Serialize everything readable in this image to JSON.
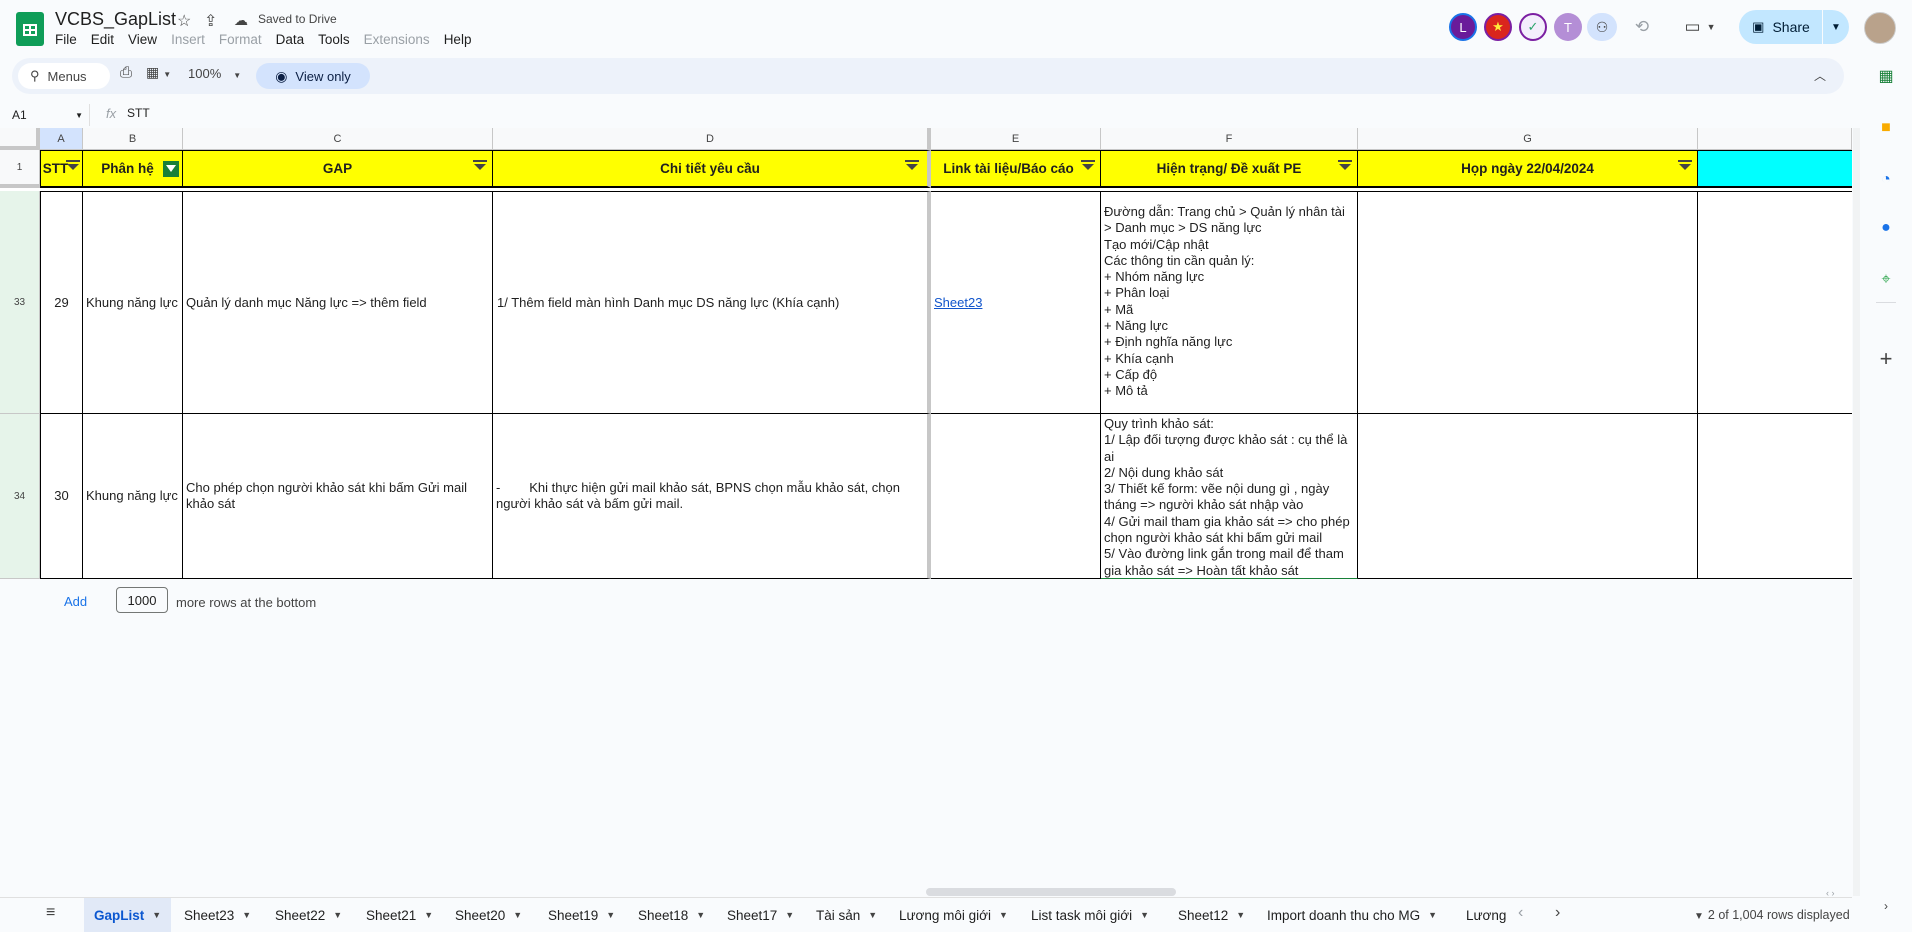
{
  "app": {
    "doc_title": "VCBS_GapList",
    "saved_status": "Saved to Drive",
    "menu": [
      "File",
      "Edit",
      "View",
      "Insert",
      "Format",
      "Data",
      "Tools",
      "Extensions",
      "Help"
    ],
    "share_label": "Share",
    "avatars": [
      {
        "letter": "L",
        "color": "#6a1b9a"
      },
      {
        "letter": "★",
        "color": "#da251d"
      },
      {
        "letter": "",
        "color": "#e8e0f8"
      },
      {
        "letter": "T",
        "color": "#b48ed6"
      }
    ]
  },
  "toolbar": {
    "menus_label": "Menus",
    "zoom": "100%",
    "view_only": "View only"
  },
  "formula": {
    "cell_ref": "A1",
    "fx": "fx",
    "value": "STT"
  },
  "columns": [
    "A",
    "B",
    "C",
    "D",
    "E",
    "F",
    "G"
  ],
  "header_row": {
    "row_num": "1",
    "cells": [
      "STT",
      "Phân hệ",
      "GAP",
      "Chi tiết yêu cầu",
      "Link tài liệu/Báo cáo",
      "Hiện trạng/ Đề xuất PE",
      "Họp ngày 22/04/2024"
    ]
  },
  "rows": [
    {
      "row_num": "33",
      "stt": "29",
      "phan_he": "Khung năng lực",
      "gap": "Quản lý danh mục Năng lực => thêm field",
      "chi_tiet": "1/ Thêm field màn hình Danh mục DS năng lực (Khía cạnh)",
      "link": "Sheet23",
      "hien_trang": "Đường dẫn: Trang chủ > Quản lý nhân tài > Danh mục > DS năng lực\nTạo mới/Cập nhật\nCác thông tin cần quản lý:\n+  Nhóm năng lực\n+  Phân loại\n+  Mã\n+  Năng lực\n+  Định nghĩa năng lực\n+  Khía cạnh\n+  Cấp độ\n+  Mô tả",
      "hop": ""
    },
    {
      "row_num": "34",
      "stt": "30",
      "phan_he": "Khung năng lực",
      "gap": "Cho phép chọn người khảo sát khi bấm Gửi mail khảo sát",
      "chi_tiet": "-        Khi thực hiện gửi mail khảo sát, BPNS chọn mẫu khảo sát, chọn người khảo sát và bấm gửi mail.",
      "link": "",
      "hien_trang": "Quy trình khảo sát:\n1/ Lập đối tượng được khảo sát : cụ thể là ai\n2/ Nội dung khảo sát\n3/ Thiết kế form: vẽe nội dung gì , ngày tháng => người khảo sát nhập vào\n4/ Gửi mail tham gia khảo sát => cho phép chọn người khảo sát khi bấm gửi mail\n5/ Vào đường link gắn trong mail để tham gia khảo sát => Hoàn tất khảo sát",
      "hop": ""
    }
  ],
  "add_rows": {
    "button": "Add",
    "count": "1000",
    "suffix": "more rows at the bottom"
  },
  "tabs": [
    "GapList",
    "Sheet23",
    "Sheet22",
    "Sheet21",
    "Sheet20",
    "Sheet19",
    "Sheet18",
    "Sheet17",
    "Tài sản",
    "Lương môi giới",
    "List task môi giới",
    "Sheet12",
    "Import doanh thu cho MG",
    "Lương"
  ],
  "active_tab": "GapList",
  "rows_displayed": "2 of 1,004 rows displayed",
  "colors": {
    "header_fill": "#ffff00",
    "extra_header_fill": "#00ffff",
    "accent": "#0b57d0",
    "share_bg": "#c2e7ff"
  }
}
